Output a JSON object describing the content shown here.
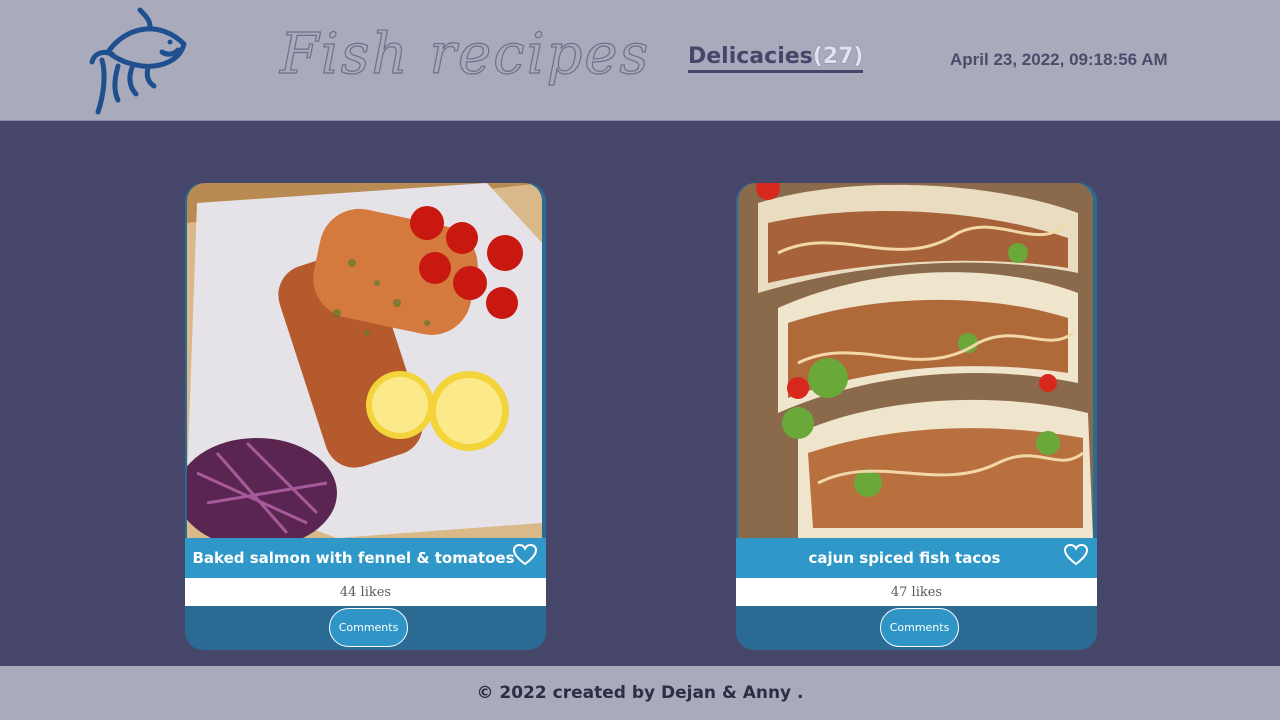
{
  "header": {
    "title": "Fish recipes",
    "nav_label": "Delicacies",
    "nav_count_text": "(27)",
    "datetime": "April 23, 2022, 09:18:56 AM"
  },
  "cards": [
    {
      "title": "Baked salmon with fennel & tomatoes",
      "likes": "44 likes",
      "comments_label": "Comments"
    },
    {
      "title": "cajun spiced fish tacos",
      "likes": "47 likes",
      "comments_label": "Comments"
    }
  ],
  "footer": {
    "text": "© 2022 created by Dejan & Anny ."
  },
  "icons": {
    "logo": "fish-logo-icon",
    "like": "heart-icon"
  },
  "colors": {
    "header_bg": "#a9aabc",
    "body_bg": "#46466a",
    "title_bar": "#2f98c9",
    "card_footer": "#2b6b93",
    "logo": "#1f4f8f"
  }
}
